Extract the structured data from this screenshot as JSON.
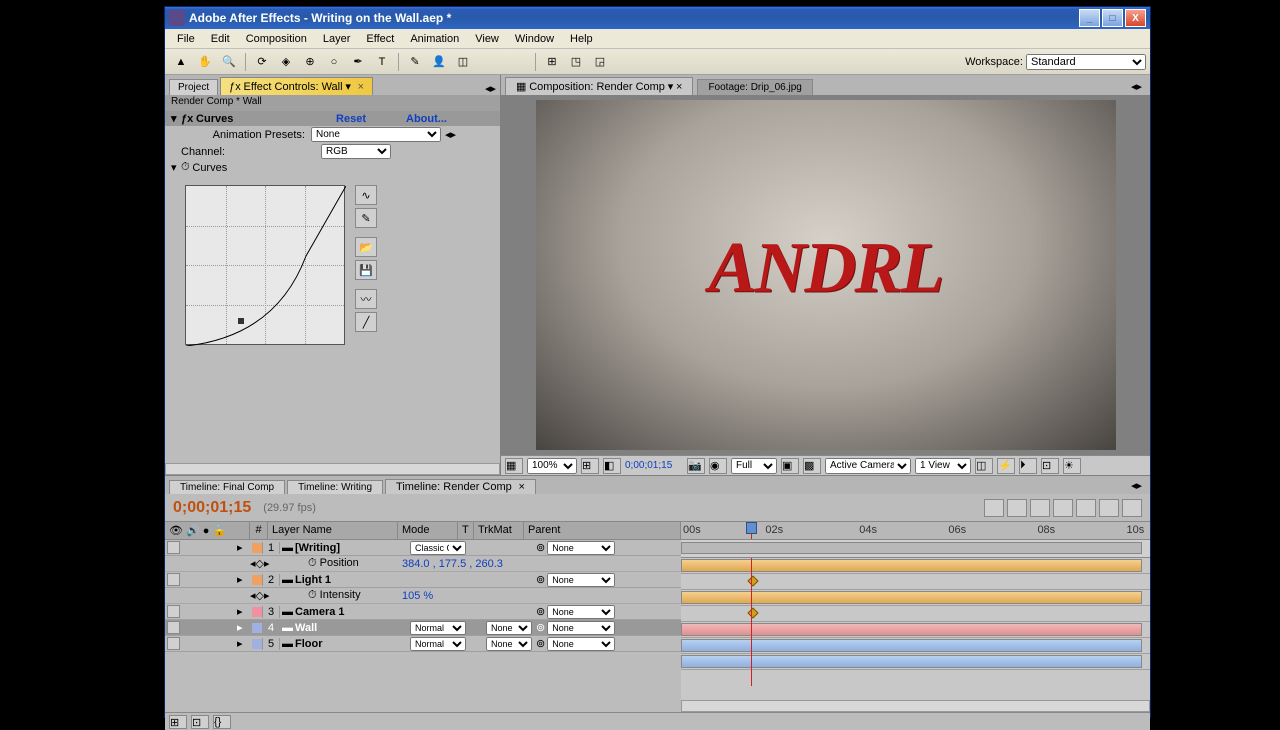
{
  "window": {
    "title": "Adobe After Effects - Writing on the Wall.aep *"
  },
  "menu": [
    "File",
    "Edit",
    "Composition",
    "Layer",
    "Effect",
    "Animation",
    "View",
    "Window",
    "Help"
  ],
  "workspace": {
    "label": "Workspace:",
    "value": "Standard"
  },
  "panels": {
    "project_tab": "Project",
    "effect_tab": "Effect Controls: Wall",
    "breadcrumb": "Render Comp * Wall"
  },
  "effect": {
    "name": "Curves",
    "reset": "Reset",
    "about": "About...",
    "presets_label": "Animation Presets:",
    "presets_value": "None",
    "channel_label": "Channel:",
    "channel_value": "RGB",
    "curves_label": "Curves"
  },
  "comp": {
    "tab_active": "Composition: Render Comp",
    "tab_footage": "Footage: Drip_06.jpg",
    "preview_text": "ANDRL"
  },
  "viewer": {
    "mag": "100%",
    "time": "0;00;01;15",
    "res": "Full",
    "camera": "Active Camera",
    "views": "1 View"
  },
  "timeline": {
    "tabs": [
      "Timeline: Final Comp",
      "Timeline: Writing",
      "Timeline: Render Comp"
    ],
    "active_tab": 2,
    "time": "0;00;01;15",
    "fps": "(29.97 fps)",
    "col_num": "#",
    "col_name": "Layer Name",
    "col_mode": "Mode",
    "col_t": "T",
    "col_trk": "TrkMat",
    "col_parent": "Parent",
    "ruler": [
      "00s",
      "02s",
      "04s",
      "06s",
      "08s",
      "10s"
    ],
    "layers": [
      {
        "num": "1",
        "name": "[Writing]",
        "color": "#f0a060",
        "mode": "Classic C",
        "trk": "",
        "parent": "None",
        "prop": "Position",
        "pval": "384.0 , 177.5 , 260.3"
      },
      {
        "num": "2",
        "name": "Light 1",
        "color": "#f0a060",
        "mode": "",
        "trk": "",
        "parent": "None",
        "prop": "Intensity",
        "pval": "105 %"
      },
      {
        "num": "3",
        "name": "Camera 1",
        "color": "#f090a0",
        "mode": "",
        "trk": "",
        "parent": "None"
      },
      {
        "num": "4",
        "name": "Wall",
        "color": "#a0b0e0",
        "mode": "Normal",
        "trk": "None",
        "parent": "None",
        "selected": true
      },
      {
        "num": "5",
        "name": "Floor",
        "color": "#a0b0e0",
        "mode": "Normal",
        "trk": "None",
        "parent": "None"
      }
    ]
  }
}
